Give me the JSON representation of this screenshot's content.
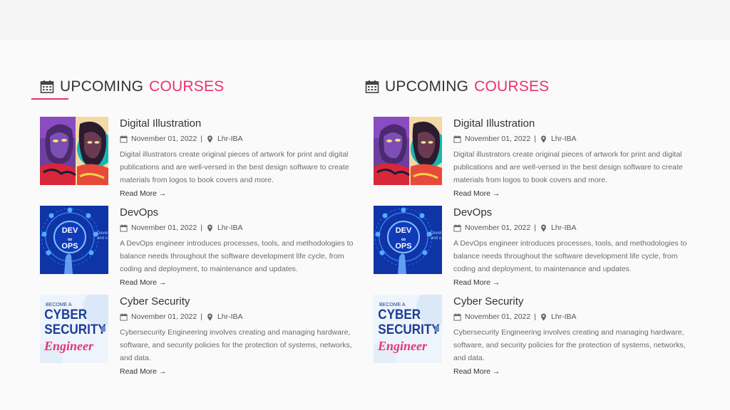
{
  "heading": {
    "prefix": "UPCOMING",
    "accent": "COURSES"
  },
  "colors": {
    "accent": "#e8336a",
    "text": "#333333",
    "muted": "#6b6b6b"
  },
  "courses": [
    {
      "title": "Digital Illustration",
      "date": "November 01, 2022",
      "separator": "|",
      "location": "Lhr-IBA",
      "description": "Digital illustrators create original pieces of artwork for print and digital publications and are well-versed in the best design software to create materials from logos to book covers and more.",
      "link": "Read More →"
    },
    {
      "title": "DevOps",
      "date": "November 01, 2022",
      "separator": "|",
      "location": "Lhr-IBA",
      "description": "A DevOps engineer introduces processes, tools, and methodologies to balance needs throughout the software development life cycle, from coding and deployment, to maintenance and updates.",
      "link": "Read More →",
      "thumb_text": [
        "DEV",
        "OPS",
        "Devel",
        "and o"
      ]
    },
    {
      "title": "Cyber Security",
      "date": "November 01, 2022",
      "separator": "|",
      "location": "Lhr-IBA",
      "description": "Cybersecurity Engineering involves creating and managing hardware, software, and security policies for the protection of systems, networks, and data.",
      "link": "Read More →",
      "thumb_text": [
        "BECOME A",
        "CYBER",
        "SECURITY",
        "Engineer"
      ]
    }
  ],
  "icons": {
    "heading": "calendar-icon",
    "date": "calendar-icon",
    "location": "map-pin-icon"
  }
}
